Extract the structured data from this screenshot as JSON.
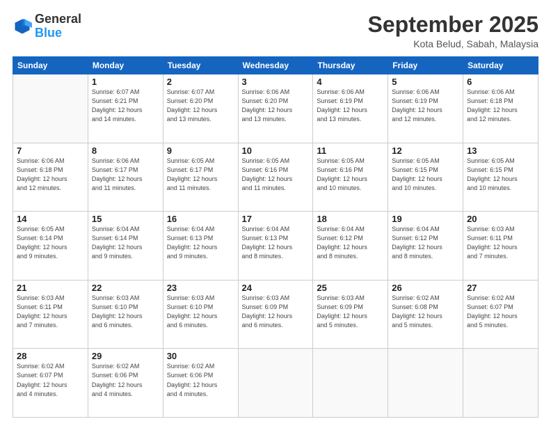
{
  "logo": {
    "general": "General",
    "blue": "Blue"
  },
  "header": {
    "month": "September 2025",
    "location": "Kota Belud, Sabah, Malaysia"
  },
  "days": [
    "Sunday",
    "Monday",
    "Tuesday",
    "Wednesday",
    "Thursday",
    "Friday",
    "Saturday"
  ],
  "weeks": [
    [
      {
        "num": "",
        "info": ""
      },
      {
        "num": "1",
        "info": "Sunrise: 6:07 AM\nSunset: 6:21 PM\nDaylight: 12 hours\nand 14 minutes."
      },
      {
        "num": "2",
        "info": "Sunrise: 6:07 AM\nSunset: 6:20 PM\nDaylight: 12 hours\nand 13 minutes."
      },
      {
        "num": "3",
        "info": "Sunrise: 6:06 AM\nSunset: 6:20 PM\nDaylight: 12 hours\nand 13 minutes."
      },
      {
        "num": "4",
        "info": "Sunrise: 6:06 AM\nSunset: 6:19 PM\nDaylight: 12 hours\nand 13 minutes."
      },
      {
        "num": "5",
        "info": "Sunrise: 6:06 AM\nSunset: 6:19 PM\nDaylight: 12 hours\nand 12 minutes."
      },
      {
        "num": "6",
        "info": "Sunrise: 6:06 AM\nSunset: 6:18 PM\nDaylight: 12 hours\nand 12 minutes."
      }
    ],
    [
      {
        "num": "7",
        "info": "Sunrise: 6:06 AM\nSunset: 6:18 PM\nDaylight: 12 hours\nand 12 minutes."
      },
      {
        "num": "8",
        "info": "Sunrise: 6:06 AM\nSunset: 6:17 PM\nDaylight: 12 hours\nand 11 minutes."
      },
      {
        "num": "9",
        "info": "Sunrise: 6:05 AM\nSunset: 6:17 PM\nDaylight: 12 hours\nand 11 minutes."
      },
      {
        "num": "10",
        "info": "Sunrise: 6:05 AM\nSunset: 6:16 PM\nDaylight: 12 hours\nand 11 minutes."
      },
      {
        "num": "11",
        "info": "Sunrise: 6:05 AM\nSunset: 6:16 PM\nDaylight: 12 hours\nand 10 minutes."
      },
      {
        "num": "12",
        "info": "Sunrise: 6:05 AM\nSunset: 6:15 PM\nDaylight: 12 hours\nand 10 minutes."
      },
      {
        "num": "13",
        "info": "Sunrise: 6:05 AM\nSunset: 6:15 PM\nDaylight: 12 hours\nand 10 minutes."
      }
    ],
    [
      {
        "num": "14",
        "info": "Sunrise: 6:05 AM\nSunset: 6:14 PM\nDaylight: 12 hours\nand 9 minutes."
      },
      {
        "num": "15",
        "info": "Sunrise: 6:04 AM\nSunset: 6:14 PM\nDaylight: 12 hours\nand 9 minutes."
      },
      {
        "num": "16",
        "info": "Sunrise: 6:04 AM\nSunset: 6:13 PM\nDaylight: 12 hours\nand 9 minutes."
      },
      {
        "num": "17",
        "info": "Sunrise: 6:04 AM\nSunset: 6:13 PM\nDaylight: 12 hours\nand 8 minutes."
      },
      {
        "num": "18",
        "info": "Sunrise: 6:04 AM\nSunset: 6:12 PM\nDaylight: 12 hours\nand 8 minutes."
      },
      {
        "num": "19",
        "info": "Sunrise: 6:04 AM\nSunset: 6:12 PM\nDaylight: 12 hours\nand 8 minutes."
      },
      {
        "num": "20",
        "info": "Sunrise: 6:03 AM\nSunset: 6:11 PM\nDaylight: 12 hours\nand 7 minutes."
      }
    ],
    [
      {
        "num": "21",
        "info": "Sunrise: 6:03 AM\nSunset: 6:11 PM\nDaylight: 12 hours\nand 7 minutes."
      },
      {
        "num": "22",
        "info": "Sunrise: 6:03 AM\nSunset: 6:10 PM\nDaylight: 12 hours\nand 6 minutes."
      },
      {
        "num": "23",
        "info": "Sunrise: 6:03 AM\nSunset: 6:10 PM\nDaylight: 12 hours\nand 6 minutes."
      },
      {
        "num": "24",
        "info": "Sunrise: 6:03 AM\nSunset: 6:09 PM\nDaylight: 12 hours\nand 6 minutes."
      },
      {
        "num": "25",
        "info": "Sunrise: 6:03 AM\nSunset: 6:09 PM\nDaylight: 12 hours\nand 5 minutes."
      },
      {
        "num": "26",
        "info": "Sunrise: 6:02 AM\nSunset: 6:08 PM\nDaylight: 12 hours\nand 5 minutes."
      },
      {
        "num": "27",
        "info": "Sunrise: 6:02 AM\nSunset: 6:07 PM\nDaylight: 12 hours\nand 5 minutes."
      }
    ],
    [
      {
        "num": "28",
        "info": "Sunrise: 6:02 AM\nSunset: 6:07 PM\nDaylight: 12 hours\nand 4 minutes."
      },
      {
        "num": "29",
        "info": "Sunrise: 6:02 AM\nSunset: 6:06 PM\nDaylight: 12 hours\nand 4 minutes."
      },
      {
        "num": "30",
        "info": "Sunrise: 6:02 AM\nSunset: 6:06 PM\nDaylight: 12 hours\nand 4 minutes."
      },
      {
        "num": "",
        "info": ""
      },
      {
        "num": "",
        "info": ""
      },
      {
        "num": "",
        "info": ""
      },
      {
        "num": "",
        "info": ""
      }
    ]
  ]
}
